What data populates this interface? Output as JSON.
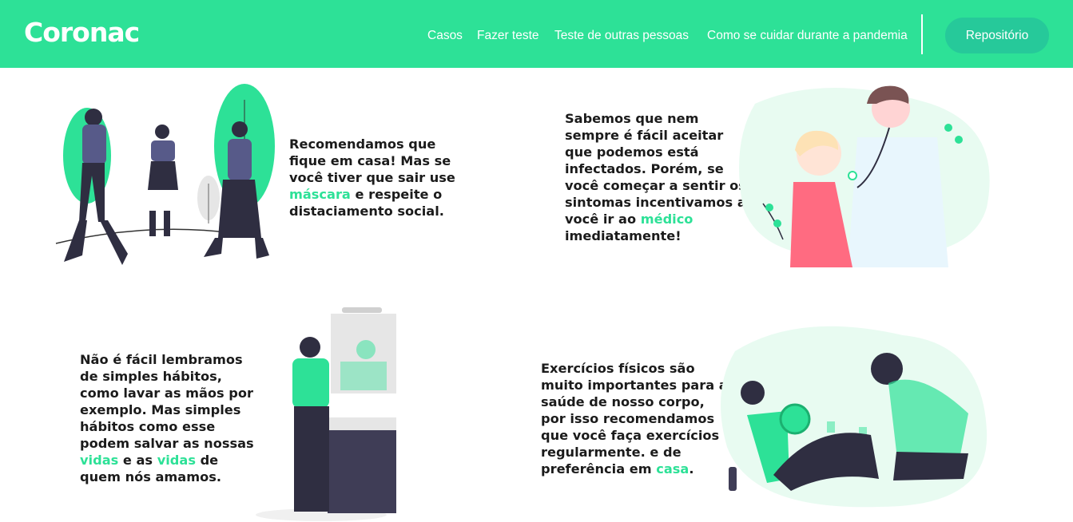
{
  "header": {
    "logo": "Coronac",
    "nav": [
      "Casos",
      "Fazer teste",
      "Teste de outras pessoas",
      "Como se cuidar durante a pandemia"
    ],
    "repo_button": "Repositório"
  },
  "colors": {
    "brand": "#2de197",
    "button": "#26c99a",
    "text": "#1b1b1b"
  },
  "cards": [
    {
      "parts": [
        "Recomendamos que fique em casa! Mas se você tiver que sair use ",
        "máscara",
        " e respeite o distaciamento social."
      ]
    },
    {
      "parts": [
        "Sabemos que nem sempre é fácil aceitar que podemos está infectados. Porém, se você começar a sentir os sintomas incentivamos a você ir ao ",
        "médico",
        " imediatamente!"
      ]
    },
    {
      "parts": [
        "Não é fácil lembramos de simples hábitos, como lavar as mãos por exemplo. Mas simples hábitos como esse podem salvar as nossas ",
        "vidas",
        " e as ",
        "vidas",
        " de quem nós amamos."
      ]
    },
    {
      "parts": [
        "Exercícios físicos são muito importantes para a saúde de nosso corpo, por isso recomendamos que você faça exercícios regularmente. e de preferência em ",
        "casa",
        "."
      ]
    }
  ],
  "illustrations": [
    "people-walking-with-masks-illustration",
    "doctor-patient-illustration",
    "washing-hands-illustration",
    "exercise-illustration"
  ]
}
